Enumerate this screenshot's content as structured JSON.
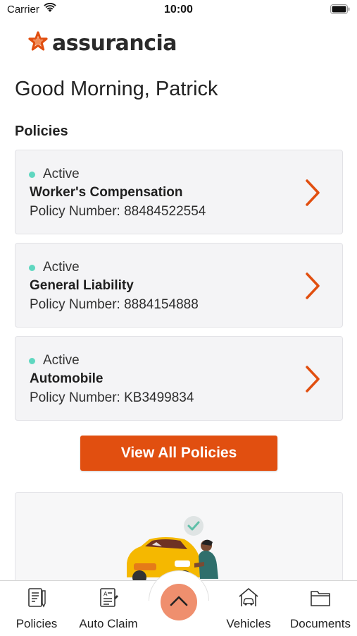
{
  "status_bar": {
    "carrier": "Carrier",
    "time": "10:00"
  },
  "brand": {
    "name": "assurancia",
    "accent_color": "#e14f10"
  },
  "greeting": "Good Morning, Patrick",
  "policies_section": {
    "title": "Policies",
    "items": [
      {
        "status": "Active",
        "name": "Worker's Compensation",
        "number": "Policy Number: 88484522554"
      },
      {
        "status": "Active",
        "name": "General Liability",
        "number": "Policy Number: 8884154888"
      },
      {
        "status": "Active",
        "name": "Automobile",
        "number": "Policy Number: KB3499834"
      }
    ],
    "view_all_label": "View All Policies"
  },
  "tab_bar": {
    "items": [
      {
        "label": "Policies",
        "icon": "policies-document-icon"
      },
      {
        "label": "Auto Claim",
        "icon": "auto-claim-form-icon"
      },
      {
        "label": "Vehicles",
        "icon": "vehicles-garage-icon"
      },
      {
        "label": "Documents",
        "icon": "documents-folder-icon"
      }
    ],
    "center_button_icon": "chevron-up-icon"
  },
  "colors": {
    "active_dot": "#5fd7c0",
    "fab": "#ef8f6e",
    "card_bg": "#f4f4f6"
  }
}
